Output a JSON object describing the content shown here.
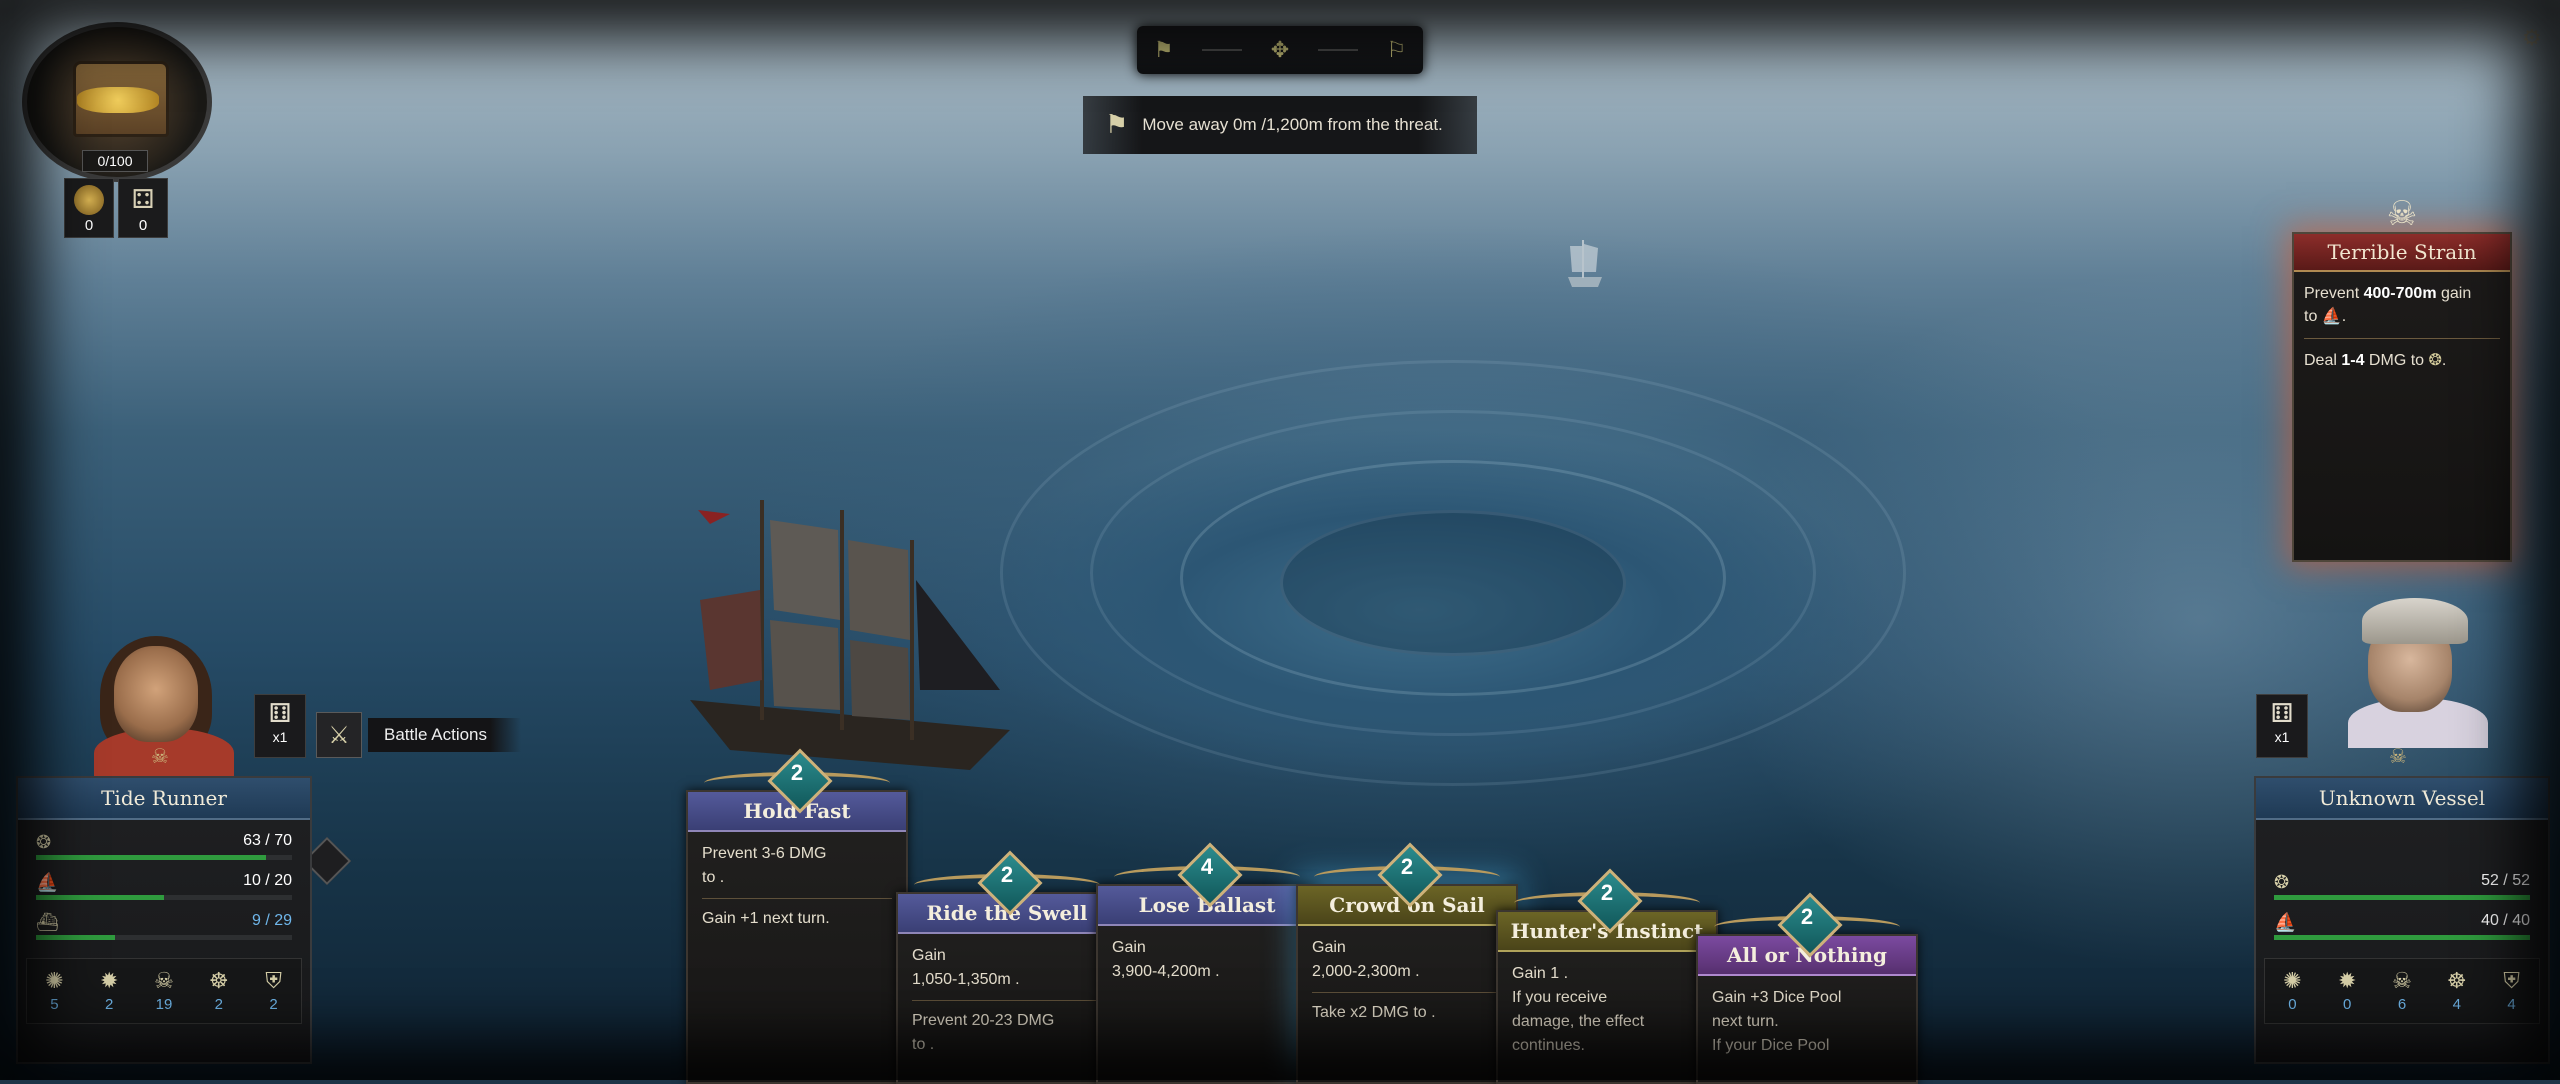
{
  "objective": {
    "steps": [
      "map-icon",
      "gear-map-icon",
      "flag-icon"
    ],
    "text": "Move away 0m /1,200m from the threat."
  },
  "treasure": {
    "count": "0/100"
  },
  "resources": [
    {
      "icon": "gold-coin-icon",
      "value": "0"
    },
    {
      "icon": "crew-icon",
      "value": "0"
    }
  ],
  "enemy_intent": {
    "title": "Terrible Strain",
    "line1_pre": "Prevent ",
    "line1_bold": "400-700m",
    "line1_post": " gain",
    "line1b_pre": "to ",
    "line1b_post": ".",
    "line2_pre": "Deal ",
    "line2_bold": "1-4",
    "line2_post": " DMG to ",
    "line2_end": "."
  },
  "player": {
    "name": "Tide Runner",
    "stats": [
      {
        "icon": "hull-icon",
        "value": "63 / 70",
        "fill": 0.9
      },
      {
        "icon": "sail-icon",
        "value": "10 / 20",
        "fill": 0.5
      },
      {
        "icon": "distance-icon",
        "value": "9 / 29",
        "fill": 0.31
      }
    ],
    "attributes": [
      {
        "icon": "navigation-icon",
        "value": "5"
      },
      {
        "icon": "cannon-icon",
        "value": "2"
      },
      {
        "icon": "crew-skull-icon",
        "value": "19"
      },
      {
        "icon": "wheel-icon",
        "value": "2"
      },
      {
        "icon": "shield-icon",
        "value": "2"
      }
    ],
    "dice_multiplier": "x1",
    "battle_actions_label": "Battle Actions"
  },
  "enemy": {
    "name": "Unknown Vessel",
    "stats": [
      {
        "icon": "hull-icon",
        "value": "52 / 52",
        "fill": 1
      },
      {
        "icon": "sail-icon",
        "value": "40 / 40",
        "fill": 1
      }
    ],
    "attributes": [
      {
        "icon": "navigation-icon",
        "value": "0"
      },
      {
        "icon": "cannon-icon",
        "value": "0"
      },
      {
        "icon": "crew-skull-icon",
        "value": "6"
      },
      {
        "icon": "wheel-icon",
        "value": "4"
      },
      {
        "icon": "shield-icon",
        "value": "4"
      }
    ],
    "dice_multiplier": "x1"
  },
  "cards": [
    {
      "cost": "2",
      "title": "Hold Fast",
      "lines": [
        "Prevent 3-6 DMG",
        "to .",
        "Gain +1 next turn."
      ]
    },
    {
      "cost": "2",
      "title": "Ride the Swell",
      "lines": [
        "Gain",
        "1,050-1,350m .",
        "Prevent 20-23 DMG",
        "to ."
      ]
    },
    {
      "cost": "4",
      "title": "Lose Ballast",
      "lines": [
        "Gain",
        "3,900-4,200m ."
      ]
    },
    {
      "cost": "2",
      "title": "Crowd on Sail",
      "lines": [
        "Gain",
        "2,000-2,300m .",
        "Take x2 DMG to ."
      ]
    },
    {
      "cost": "2",
      "title": "Hunter's Instinct",
      "lines": [
        "Gain 1 .",
        "If you receive",
        "damage, the effect",
        "continues."
      ]
    },
    {
      "cost": "2",
      "title": "All or Nothing",
      "lines": [
        "Gain +3 Dice Pool",
        "next turn.",
        "If your Dice Pool"
      ]
    }
  ],
  "colors": {
    "health": "#2f9b3e",
    "accent_blue": "#6fb6ea",
    "intent_red": "#8c2d2a"
  }
}
